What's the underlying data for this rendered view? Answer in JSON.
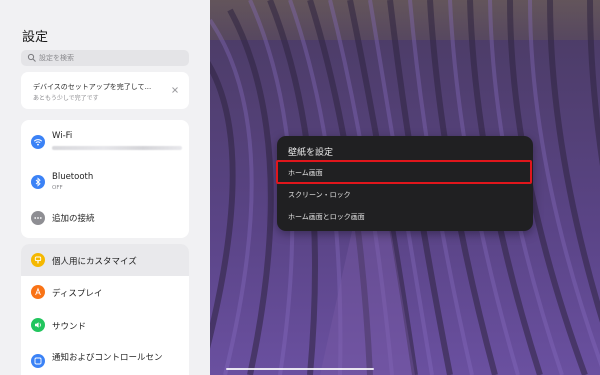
{
  "settings": {
    "title": "設定",
    "search_placeholder": "設定を検索",
    "setup": {
      "line1": "デバイスのセットアップを完了して...",
      "line2": "あともう少しで完了です"
    },
    "connections": [
      {
        "label": "Wi-Fi",
        "sub": "",
        "icon": "wifi-icon",
        "color": "#3b82f6"
      },
      {
        "label": "Bluetooth",
        "sub": "OFF",
        "icon": "bluetooth-icon",
        "color": "#3b82f6"
      },
      {
        "label": "追加の接続",
        "sub": "",
        "icon": "more-dots-icon",
        "color": "#8e8e93"
      }
    ],
    "personal": [
      {
        "label": "個人用にカスタマイズ",
        "icon": "palette-icon",
        "color": "#f5b800"
      },
      {
        "label": "ディスプレイ",
        "icon": "display-icon",
        "color": "#f97316"
      },
      {
        "label": "サウンド",
        "icon": "sound-icon",
        "color": "#22c55e"
      },
      {
        "label": "通知およびコントロールセン",
        "icon": "notification-icon",
        "color": "#3b82f6"
      }
    ]
  },
  "popup": {
    "title": "壁紙を設定",
    "items": [
      "ホーム画面",
      "スクリーン・ロック",
      "ホーム画面とロック画面"
    ]
  },
  "colors": {
    "highlight": "#e0161c",
    "wallpaper": "#4d3c6e"
  }
}
